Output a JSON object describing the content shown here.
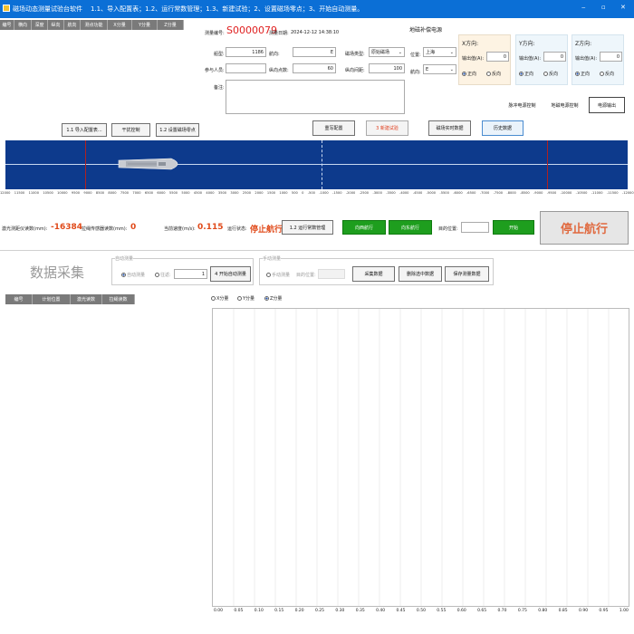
{
  "titlebar": {
    "app_name": "磁场动态测量试验台软件",
    "instructions": "1.1、导入配置表；1.2、运行常数管理；1.3、新建试验；2、设置磁场零点；3、开始自动测量。",
    "min": "‒",
    "max": "▫",
    "close": "✕"
  },
  "top_table": {
    "headers": [
      "编号",
      "横向",
      "深度",
      "纵向",
      "航向",
      "测点功能",
      "X分量",
      "Y分量",
      "Z分量"
    ]
  },
  "info": {
    "id_label": "测量编号:",
    "id_value": "S0000079",
    "date_label": "测量日期:",
    "date_value": "2024-12-12 14:38:10",
    "boat_label": "船型:",
    "boat_value": "1186",
    "heading_label": "航向:",
    "heading_value": "E",
    "person_label": "参与人员:",
    "person_value": "",
    "points_label": "纵向点数:",
    "points_value": "60",
    "field_type_label": "磁场类型:",
    "field_type_value": "原始磁场",
    "spacing_label": "纵向间距:",
    "spacing_value": "100",
    "note_label": "备注:",
    "note_value": ""
  },
  "geo": {
    "title": "地磁补偿电源",
    "location_label": "位置:",
    "location_value": "上海",
    "heading_label": "航向:",
    "heading_value": "E",
    "axes": [
      {
        "title": "X方向:",
        "out_label": "输出值(A):",
        "value": "0",
        "pos": "正向",
        "neg": "反向"
      },
      {
        "title": "Y方向:",
        "out_label": "输出值(A):",
        "value": "0",
        "pos": "正向",
        "neg": "反向"
      },
      {
        "title": "Z方向:",
        "out_label": "输出值(A):",
        "value": "0",
        "pos": "正向",
        "neg": "反向"
      }
    ],
    "pulse_btn": "脉冲电源控制",
    "earth_btn": "地磁电源控制",
    "output_btn": "电源输出"
  },
  "toolbar": {
    "import": "1.1 导入配置表...",
    "interfere": "干扰控制",
    "zero": "1.2 设置磁场零点",
    "load": "重写配置",
    "new_test": "3 新建试验",
    "realtime": "磁场实时数据",
    "history": "历史数据"
  },
  "ruler": {
    "ticks": [
      "12000",
      "11500",
      "11000",
      "10500",
      "10000",
      "9500",
      "9000",
      "8500",
      "8000",
      "7500",
      "7000",
      "6500",
      "6000",
      "5500",
      "5000",
      "4500",
      "4000",
      "3500",
      "3000",
      "2500",
      "2000",
      "1500",
      "1000",
      "500",
      "0",
      "-500",
      "-1000",
      "-1500",
      "-2000",
      "-2500",
      "-3000",
      "-3500",
      "-4000",
      "-4500",
      "-5000",
      "-5500",
      "-6000",
      "-6500",
      "-7000",
      "-7500",
      "-8000",
      "-8500",
      "-9000",
      "-9500",
      "-10000",
      "-10500",
      "-11000",
      "-11500",
      "-12000"
    ]
  },
  "status": {
    "laser_label": "激光测距仪读数(mm):",
    "laser_value": "-16384",
    "encoder_label": "拉绳传感器读数(mm):",
    "encoder_value": "0",
    "speed_label": "当前速度(m/s):",
    "speed_value": "0.115",
    "state_label": "运行状态:",
    "state_value": "停止航行",
    "constants_btn": "1.2 运行常数管理",
    "west_btn": "向西航行",
    "east_btn": "向东航行",
    "target_label": "目的位置:",
    "target_value": "",
    "start_btn": "开始",
    "stop_btn": "停止航行"
  },
  "acq": {
    "title": "数据采集",
    "auto_group": "自动测量",
    "auto_radio": "自动测量",
    "cycle_label": "往返:",
    "cycle_value": "1",
    "auto_start_btn": "4 开始自动测量",
    "manual_group": "手动测量",
    "manual_radio": "手动测量",
    "target_label": "目的位置:",
    "target_value": "",
    "collect_btn": "采集数据",
    "delete_btn": "删除选中数据",
    "save_btn": "保存测量数据",
    "table_headers": [
      "编号",
      "计划位置",
      "激光读数",
      "拉绳读数"
    ],
    "comp_x": "X分量",
    "comp_y": "Y分量",
    "comp_z": "Z分量",
    "x_ticks": [
      "0.00",
      "0.05",
      "0.10",
      "0.15",
      "0.20",
      "0.25",
      "0.30",
      "0.35",
      "0.40",
      "0.45",
      "0.50",
      "0.55",
      "0.60",
      "0.65",
      "0.70",
      "0.75",
      "0.80",
      "0.85",
      "0.90",
      "0.95",
      "1.00"
    ]
  }
}
